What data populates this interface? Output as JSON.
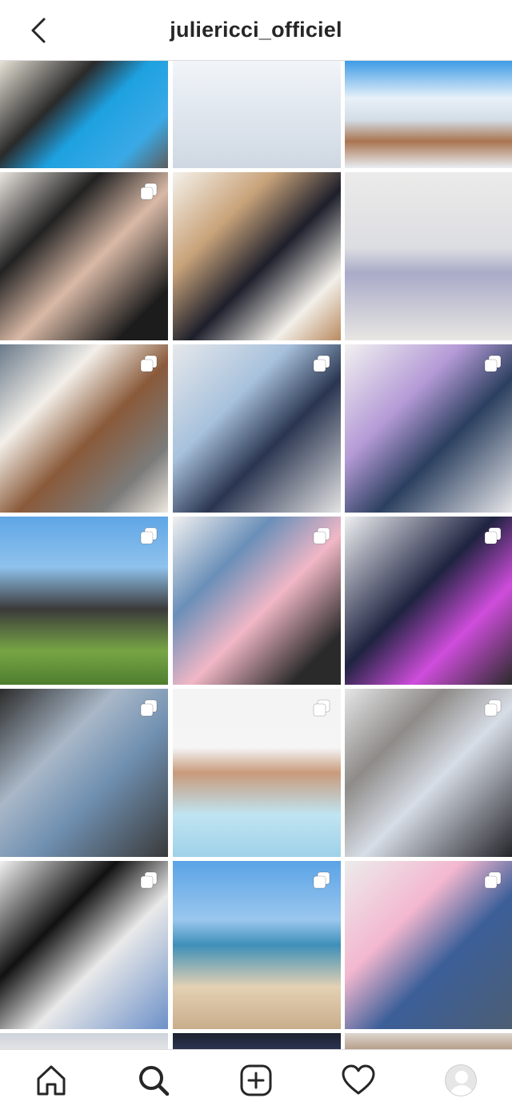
{
  "header": {
    "username": "juliericci_officiel"
  },
  "tabs": [
    {
      "name": "home-icon"
    },
    {
      "name": "search-icon"
    },
    {
      "name": "add-post-icon"
    },
    {
      "name": "heart-icon"
    },
    {
      "name": "profile-avatar"
    }
  ],
  "posts": [
    {
      "multi": false,
      "bg": "linear-gradient(135deg,#e7e2d6 0%,#2a2a2a 35%,#1ea1e0 55%,#3aa9e6 80%,#5d5d5d 100%)"
    },
    {
      "multi": false,
      "bg": "linear-gradient(180deg,#f2f5f9 0%,#dfe6ee 50%,#cfd8e2 100%)"
    },
    {
      "multi": false,
      "bg": "linear-gradient(180deg,#3d9be6 0%,#e8f1f8 35%,#d3dde6 55%,#a97450 75%,#e9eef2 100%)"
    },
    {
      "multi": true,
      "bg": "linear-gradient(135deg,#e9e4de 0%,#222 30%,#d9b9a6 55%,#1c1c1c 85%)"
    },
    {
      "multi": false,
      "bg": "linear-gradient(135deg,#f4f1ea 0%,#c9a37a 30%,#1d1f2b 55%,#f2efe9 80%,#b98a5f 100%)"
    },
    {
      "multi": false,
      "bg": "linear-gradient(180deg,#ecebea 0%,#dcdde2 45%,#a9abc8 60%,#e8e6e3 100%)"
    },
    {
      "multi": true,
      "bg": "linear-gradient(135deg,#6a7a8a 0%,#f3efe9 30%,#8a5a3a 55%,#7b7b7b 80%,#efe9df 100%)"
    },
    {
      "multi": true,
      "bg": "linear-gradient(135deg,#e6e8eb 0%,#a7c1dc 35%,#2a3550 60%,#e3e3e3 100%)"
    },
    {
      "multi": true,
      "bg": "linear-gradient(135deg,#f1f1f1 0%,#b49ad6 35%,#2b3f5f 60%,#e7e7ea 100%)"
    },
    {
      "multi": true,
      "bg": "linear-gradient(180deg,#5fa6e6 0%,#8fc2ec 30%,#3b3a3a 55%,#77a545 80%,#4e7e2e 100%)"
    },
    {
      "multi": true,
      "bg": "linear-gradient(135deg,#f0f0f0 0%,#6a8fb8 30%,#f1b7c6 55%,#2a2a2a 85%)"
    },
    {
      "multi": true,
      "bg": "linear-gradient(135deg,#eef0f2 0%,#1f2340 45%,#cf4ddc 70%,#2b2b2b 100%)"
    },
    {
      "multi": true,
      "bg": "linear-gradient(135deg,#2c2c2c 0%,#a9b8c8 35%,#6f8fb0 60%,#3a3a3a 100%)"
    },
    {
      "multi": true,
      "bg": "linear-gradient(180deg,#f4f4f4 0%,#f5f5f5 35%,#c99a7b 50%,#bfe4f2 75%,#9fd1e8 100%)"
    },
    {
      "multi": true,
      "bg": "linear-gradient(135deg,#e5e6e8 0%,#8e8b88 30%,#d7dde6 55%,#25242b 100%)"
    },
    {
      "multi": true,
      "bg": "linear-gradient(135deg,#f0f0f0 0%,#111 35%,#e9e9e9 60%,#6c90c8 100%)"
    },
    {
      "multi": true,
      "bg": "linear-gradient(180deg,#5aa3e6 0%,#9ac7ee 35%,#3e8fb8 50%,#e3d1b3 75%,#c9ad8a 100%)"
    },
    {
      "multi": true,
      "bg": "linear-gradient(135deg,#ececec 0%,#f3b7cf 35%,#3c5f99 60%,#4c5e73 100%)"
    },
    {
      "multi": false,
      "bg": "linear-gradient(180deg,#cdd3da 0%,#e1e3e6 100%)"
    },
    {
      "multi": false,
      "bg": "linear-gradient(180deg,#1d2230 0%,#2b3350 100%)"
    },
    {
      "multi": false,
      "bg": "linear-gradient(180deg,#ddd6cf 0%,#b79f8b 100%)"
    }
  ]
}
